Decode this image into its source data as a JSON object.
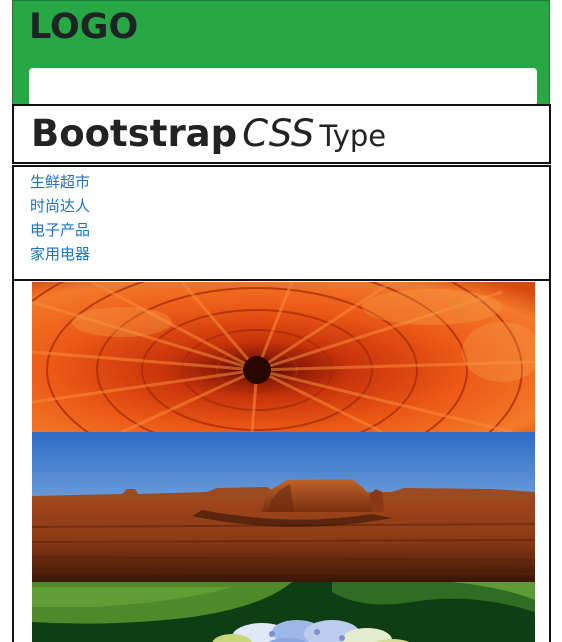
{
  "header": {
    "logo_text": "LOGO",
    "background_color": "#28a745",
    "search": {
      "value": "",
      "placeholder": ""
    }
  },
  "title": {
    "part1": "Bootstrap",
    "part2": "CSS",
    "part3": "Type"
  },
  "nav": {
    "items": [
      {
        "label": "生鲜超市"
      },
      {
        "label": "时尚达人"
      },
      {
        "label": "电子产品"
      },
      {
        "label": "家用电器"
      }
    ],
    "link_color": "#1a73c9"
  },
  "images": [
    {
      "subject": "orange-chrysanthemum-photo"
    },
    {
      "subject": "desert-mesa-photo"
    },
    {
      "subject": "blue-hydrangea-photo"
    }
  ]
}
